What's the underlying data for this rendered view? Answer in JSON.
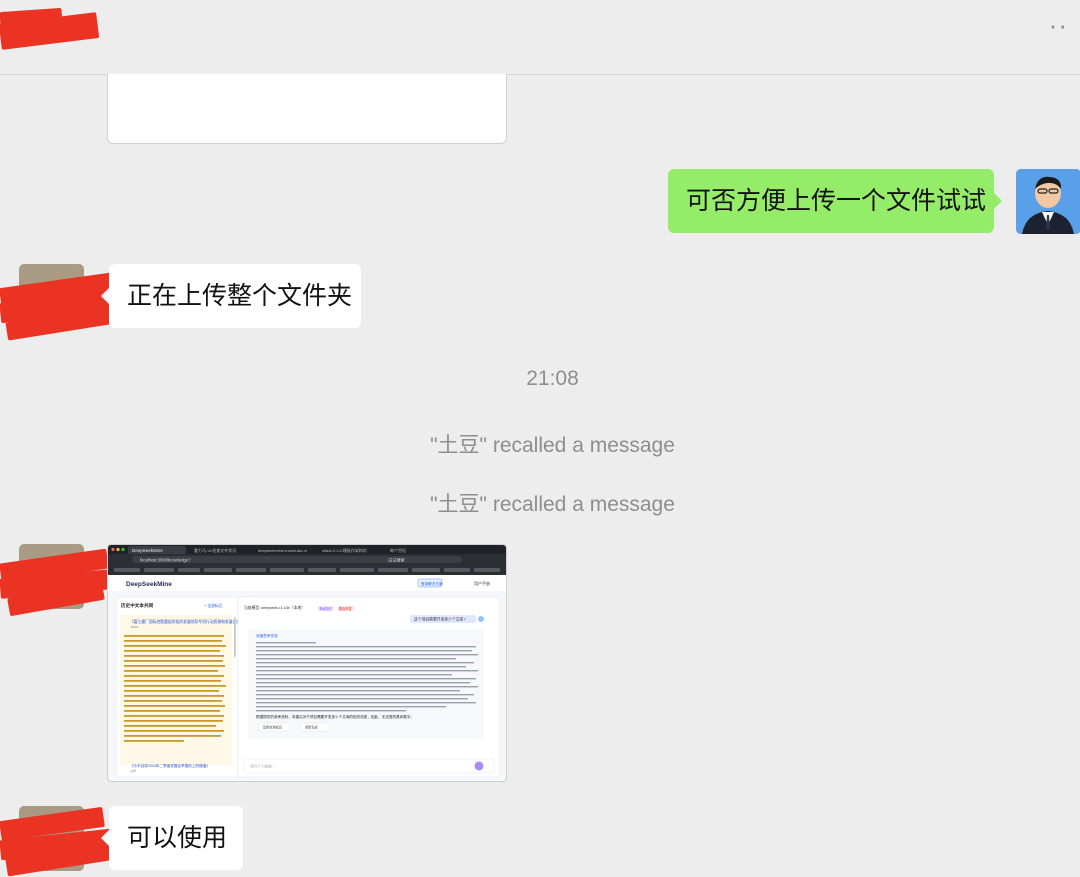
{
  "header": {
    "more_icon": "more-dots-icon"
  },
  "messages": {
    "m1": "可否方便上传一个文件试试",
    "m2": "正在上传整个文件夹",
    "time": "21:08",
    "recall1": "\"土豆\" recalled a message",
    "recall2": "\"土豆\" recalled a message",
    "m3": "可以使用"
  },
  "screenshot": {
    "tab1": "DeepSeekMine",
    "tab2": "重力马-VL检查文件状况",
    "tab3": "deepseekmine-install-aio-m",
    "tab4": "ollaol-0.1.6-模板作架构机",
    "tab5": "每个世纪",
    "url": "localhost:3000/knowledge?",
    "search_hint": "试试搜索",
    "brand": "DeepSeekMine",
    "top_btn": "登录解决方案",
    "top_link": "用户手册",
    "history_title": "历史中文本共同",
    "history_action": "+ 全部标记",
    "file1": "《富江建厂国际控股重组学组织发展领导专项行动资源和发展实施方案》",
    "file1_ext": ".docx",
    "file2": "《沙丰目前2024年二季度发展会举措执上的增值》",
    "file2_ext": ".pdf",
    "model_label": "当前模型: deepseek-r1:14b（本地）",
    "tag1": "本地知识",
    "tag2": "联合开发",
    "question": "这个项目需要开发多少个文库?",
    "answer_head": "深度思考完成",
    "answer_summary": "根据提供的参考资料，本建议对于项目需要开发多少个文库的相关信息，因此，无法提供具体数字。",
    "btn_copy": "复制本地知识",
    "btn_redo": "重新生成",
    "input_placeholder": "请问个人数据..."
  },
  "colors": {
    "green_bubble": "#95ec69",
    "white_bubble": "#ffffff",
    "redaction": "#ea3323",
    "background": "#ededed"
  }
}
